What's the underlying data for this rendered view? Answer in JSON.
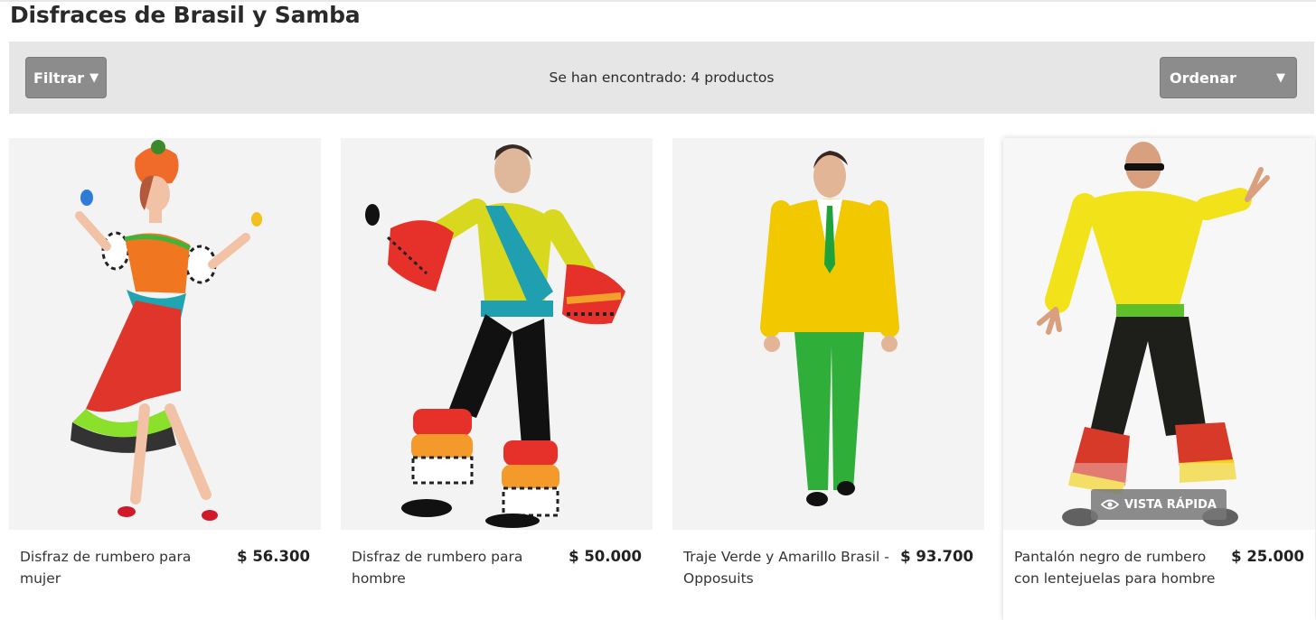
{
  "page": {
    "title": "Disfraces de Brasil y Samba"
  },
  "toolbar": {
    "filter_label": "Filtrar",
    "results_text": "Se han encontrado: 4 productos",
    "sort_label": "Ordenar"
  },
  "products": [
    {
      "name": "Disfraz de rumbero para mujer",
      "price": "$ 56.300"
    },
    {
      "name": "Disfraz de rumbero para hombre",
      "price": "$ 50.000"
    },
    {
      "name": "Traje Verde y Amarillo Brasil - Opposuits",
      "price": "$ 93.700"
    },
    {
      "name": "Pantalón negro de rumbero con lentejuelas para hombre",
      "price": "$ 25.000"
    }
  ],
  "quickview_label": "VISTA RÁPIDA",
  "colors": {
    "toolbar_bg": "#e6e6e6",
    "button_bg": "#8c8c8c",
    "card_bg": "#f3f3f3"
  }
}
